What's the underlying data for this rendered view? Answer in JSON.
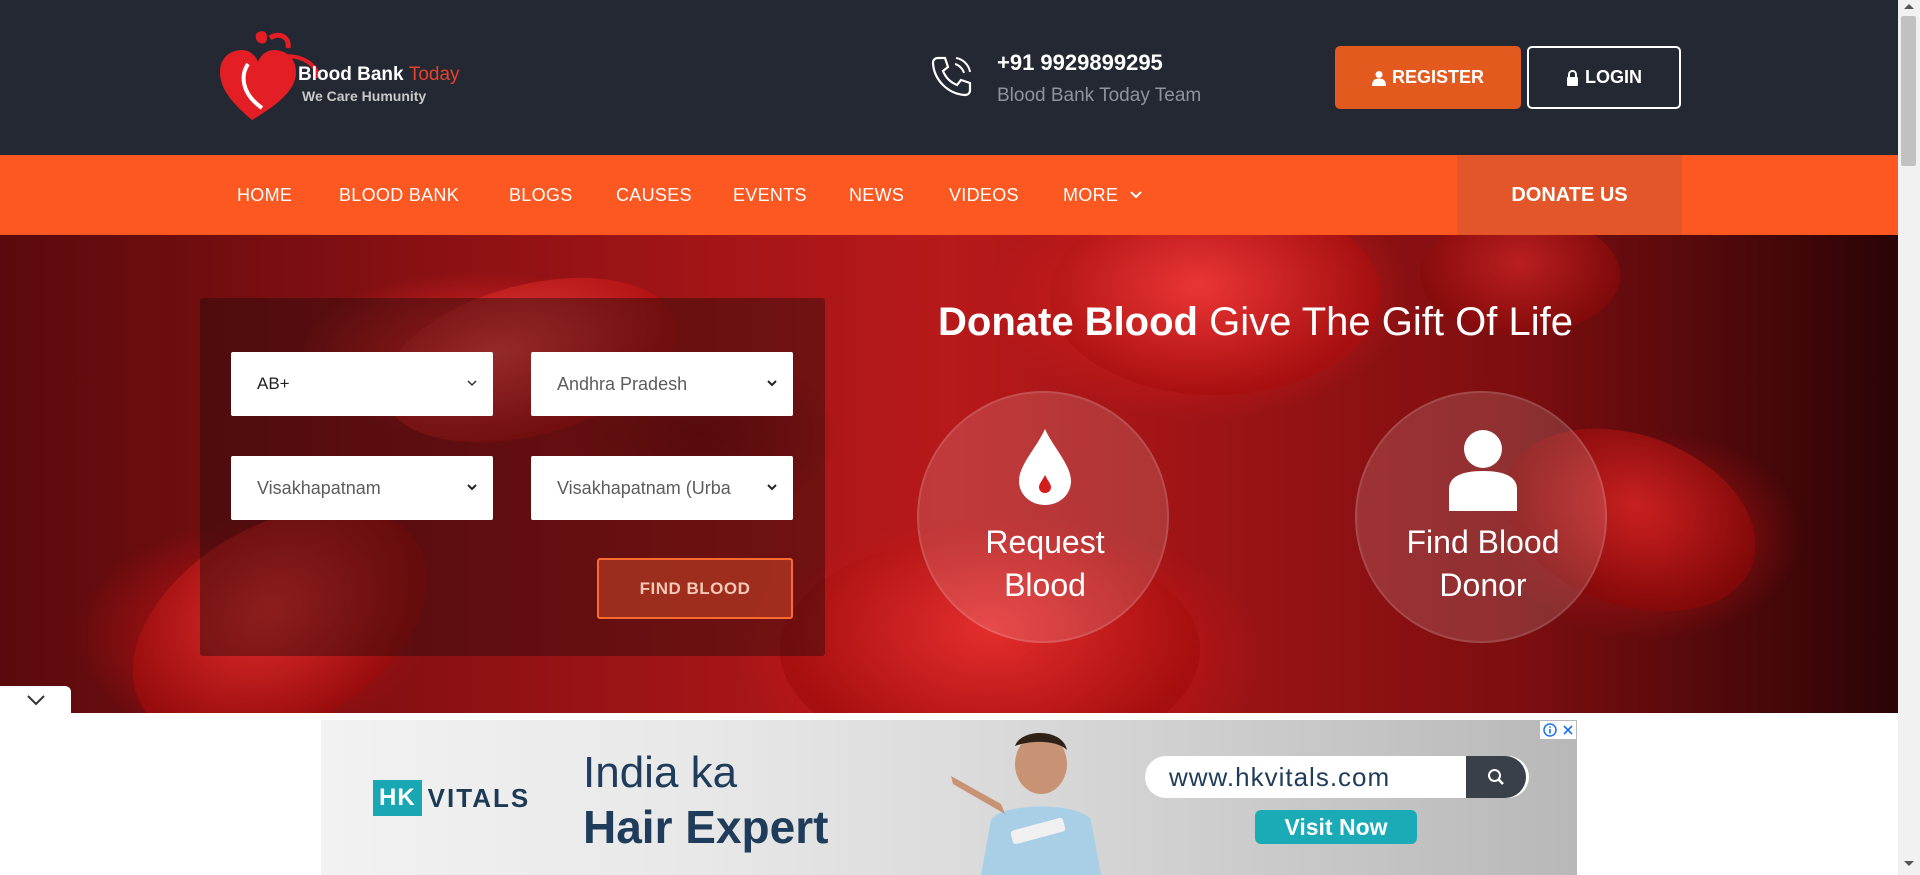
{
  "header": {
    "logo_name": "Blood Bank",
    "logo_accent": "Today",
    "logo_tagline": "We Care Humunity",
    "phone_number": "+91 9929899295",
    "phone_team": "Blood Bank Today Team",
    "register_label": "REGISTER",
    "login_label": "LOGIN"
  },
  "nav": {
    "items": [
      "HOME",
      "BLOOD BANK",
      "BLOGS",
      "CAUSES",
      "EVENTS",
      "NEWS",
      "VIDEOS",
      "MORE"
    ],
    "donate_label": "DONATE US"
  },
  "search": {
    "blood_group": "AB+",
    "state": "Andhra Pradesh",
    "district": "Visakhapatnam",
    "city": "Visakhapatnam (Urba",
    "find_label": "FIND BLOOD"
  },
  "hero": {
    "title_bold": "Donate Blood",
    "title_rest": "Give The Gift Of Life",
    "request_line1": "Request",
    "request_line2": "Blood",
    "find_line1": "Find Blood",
    "find_line2": "Donor"
  },
  "ad": {
    "brand_hk": "HK",
    "brand_vitals": "VITALS",
    "tagline1": "India ka",
    "tagline2": "Hair Expert",
    "url": "www.hkvitals.com",
    "cta": "Visit Now"
  },
  "colors": {
    "header_bg": "#232833",
    "nav_bg": "#fd5822",
    "register_bg": "#e35a1e",
    "donate_bg": "#e2562a"
  }
}
